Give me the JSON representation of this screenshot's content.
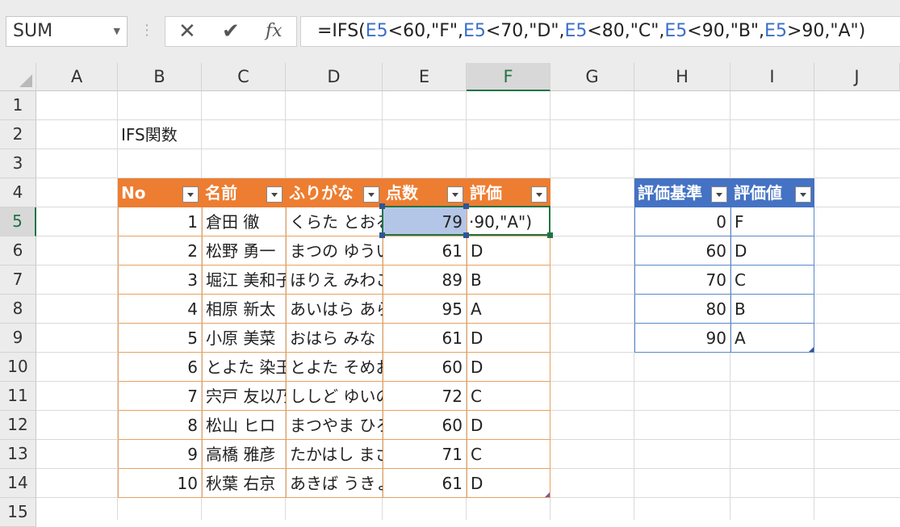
{
  "name_box": "SUM",
  "formula": {
    "prefix": "=IFS(",
    "parts": [
      {
        "ref": "E5",
        "text": "<60,\"F\","
      },
      {
        "ref": "E5",
        "text": "<70,\"D\","
      },
      {
        "ref": "E5",
        "text": "<80,\"C\","
      },
      {
        "ref": "E5",
        "text": "<90,\"B\","
      },
      {
        "ref": "E5",
        "text": ">90,\"A\")"
      }
    ]
  },
  "toolbar": {
    "cancel": "✕",
    "enter": "✔",
    "fx": "fx"
  },
  "columns": [
    "A",
    "B",
    "C",
    "D",
    "E",
    "F",
    "G",
    "H",
    "I",
    "J"
  ],
  "rows": [
    "1",
    "2",
    "3",
    "4",
    "5",
    "6",
    "7",
    "8",
    "9",
    "10",
    "11",
    "12",
    "13",
    "14",
    "15"
  ],
  "title": "IFS関数",
  "table1": {
    "headers": [
      "No",
      "名前",
      "ふりがな",
      "点数",
      "評価"
    ],
    "rows": [
      [
        "1",
        "倉田 徹",
        "くらた とおる",
        "79",
        "·90,\"A\")"
      ],
      [
        "2",
        "松野 勇一",
        "まつの ゆういち",
        "61",
        "D"
      ],
      [
        "3",
        "堀江 美和子",
        "ほりえ みわこ",
        "89",
        "B"
      ],
      [
        "4",
        "相原 新太",
        "あいはら あらた",
        "95",
        "A"
      ],
      [
        "5",
        "小原 美菜",
        "おはら みな",
        "61",
        "D"
      ],
      [
        "6",
        "とよた 染王",
        "とよた そめお",
        "60",
        "D"
      ],
      [
        "7",
        "宍戸 友以乃",
        "ししど ゆいの",
        "72",
        "C"
      ],
      [
        "8",
        "松山 ヒロ",
        "まつやま ひろ",
        "60",
        "D"
      ],
      [
        "9",
        "高橋 雅彦",
        "たかはし まさひこ",
        "71",
        "C"
      ],
      [
        "10",
        "秋葉 右京",
        "あきば うきょう",
        "61",
        "D"
      ]
    ]
  },
  "table2": {
    "headers": [
      "評価基準",
      "評価値"
    ],
    "rows": [
      [
        "0",
        "F"
      ],
      [
        "60",
        "D"
      ],
      [
        "70",
        "C"
      ],
      [
        "80",
        "B"
      ],
      [
        "90",
        "A"
      ]
    ]
  }
}
